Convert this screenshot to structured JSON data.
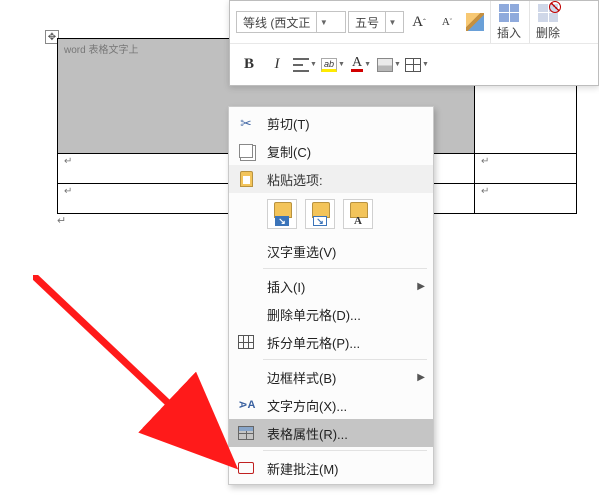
{
  "doc": {
    "selected_cell_text": "word 表格文字上",
    "para_mark": "↵"
  },
  "mini_toolbar": {
    "font_name": "等线 (西文正",
    "font_size": "五号",
    "grow_font": "A",
    "shrink_font": "A",
    "bold": "B",
    "italic": "I",
    "font_color_letter": "A",
    "insert_label": "插入",
    "delete_label": "删除"
  },
  "context_menu": {
    "cut": "剪切(T)",
    "copy": "复制(C)",
    "paste_hdr": "粘贴选项:",
    "paste_a": "A",
    "reconvert": "汉字重选(V)",
    "insert": "插入(I)",
    "del_cells": "删除单元格(D)...",
    "split": "拆分单元格(P)...",
    "border": "边框样式(B)",
    "text_dir": "文字方向(X)...",
    "tbl_props": "表格属性(R)...",
    "new_comment": "新建批注(M)"
  }
}
